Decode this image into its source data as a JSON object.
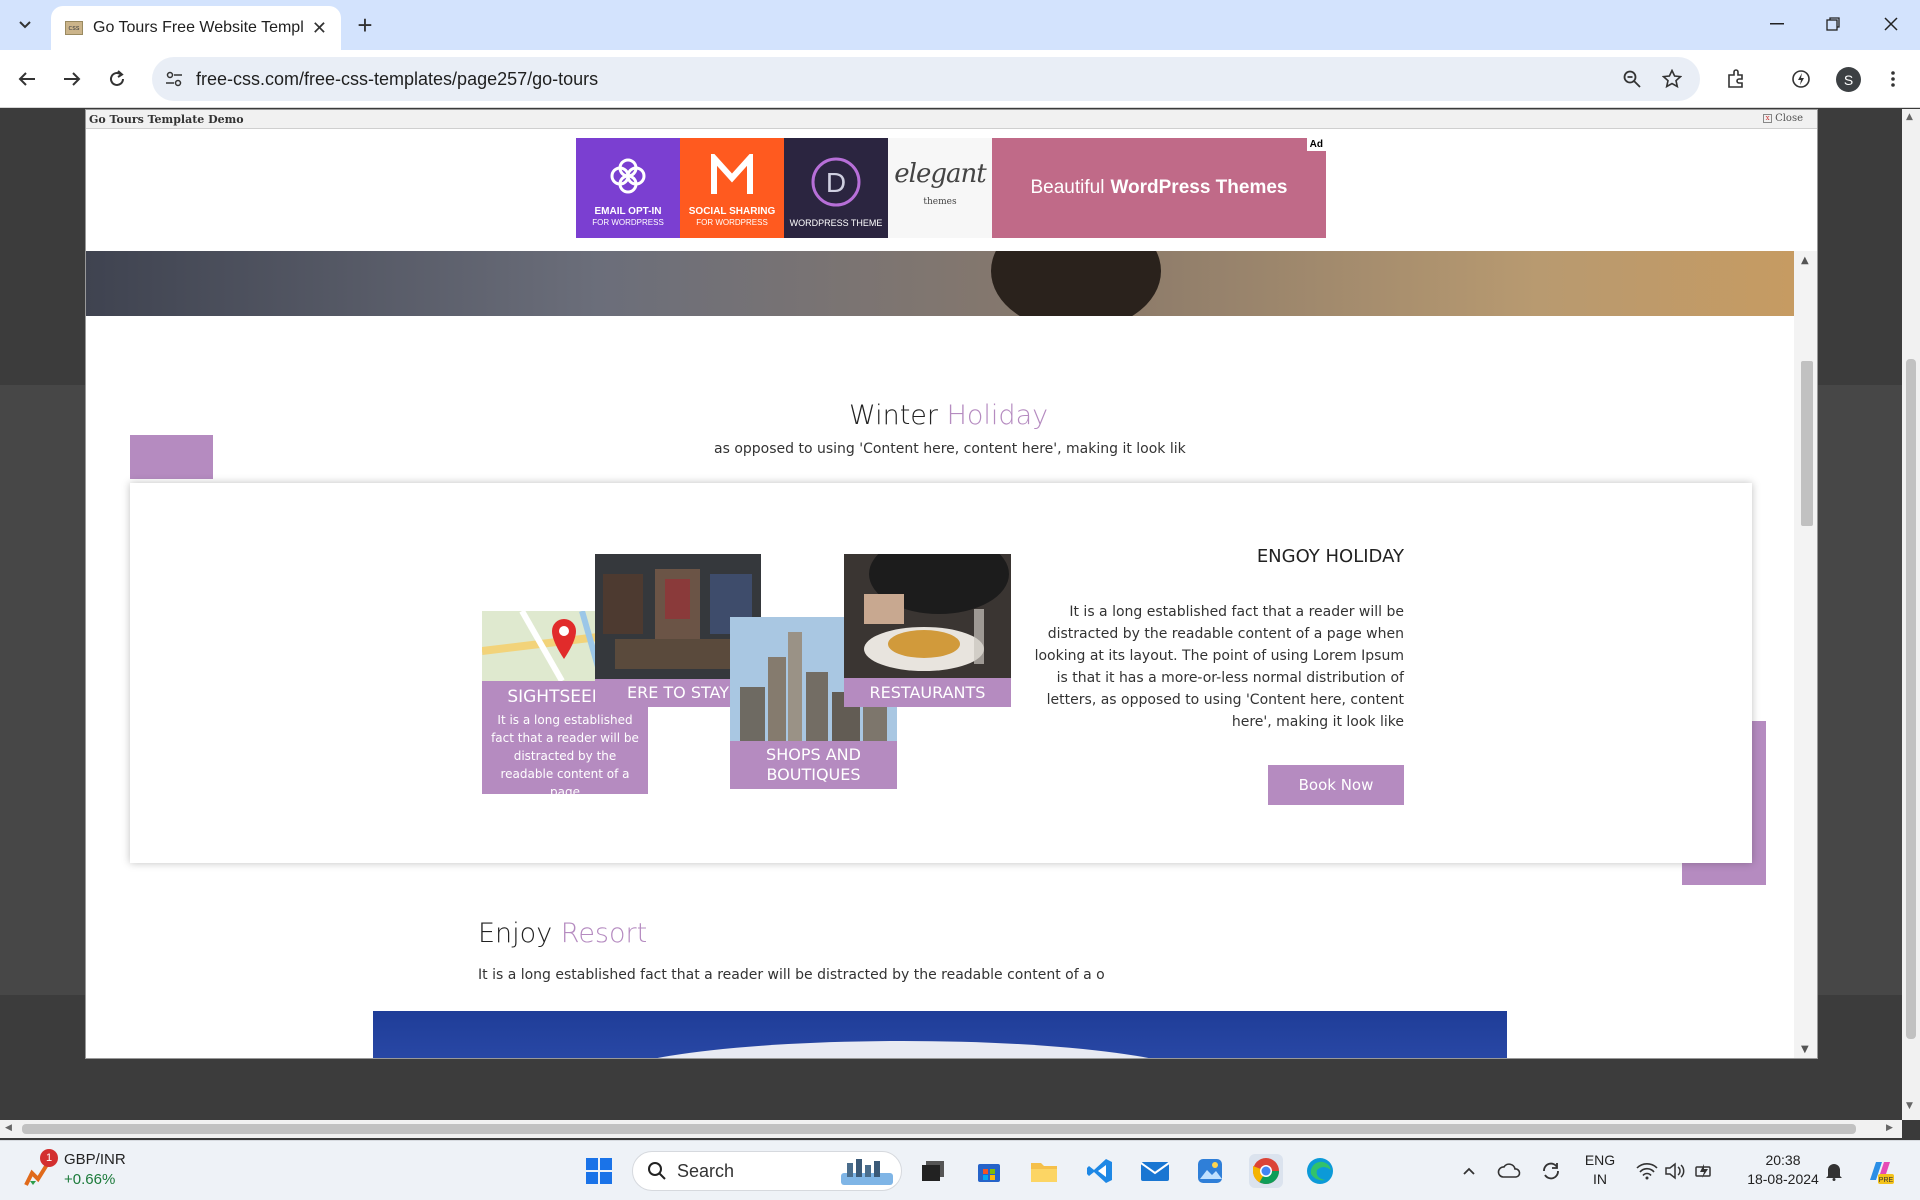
{
  "browser": {
    "tab_title": "Go Tours Free Website Template",
    "url": "free-css.com/free-css-templates/page257/go-tours",
    "profile_initial": "S"
  },
  "demo_bar": {
    "title": "Go Tours Template Demo",
    "close_label": "Close"
  },
  "ad": {
    "badge": "Ad",
    "tiles": [
      {
        "title": "EMAIL OPT-IN",
        "sub": "FOR WORDPRESS",
        "color": "#7b3fd1"
      },
      {
        "title": "SOCIAL SHARING",
        "sub": "FOR WORDPRESS",
        "color": "#ff5a1f"
      },
      {
        "title": "WORDPRESS THEME",
        "sub": "",
        "color": "#2b2540"
      }
    ],
    "elegant_logo": "elegant",
    "elegant_sub": "themes",
    "banner_prefix": "Beautiful",
    "banner_bold": "WordPress Themes"
  },
  "winter": {
    "title_plain": "Winter",
    "title_accent": "Holiday",
    "subtitle": "as opposed to using 'Content here, content here', making it look lik"
  },
  "tiles": {
    "sightseeing": {
      "label": "SIGHTSEEING",
      "text": "It is a long established fact that a reader will be distracted by the readable content of a page"
    },
    "where_to_stay": {
      "label": "ERE TO STAY"
    },
    "shops": {
      "label": "SHOPS AND BOUTIQUES"
    },
    "restaurants": {
      "label": "RESTAURANTS"
    }
  },
  "engoy": {
    "title": "ENGOY HOLIDAY",
    "text": "It is a long established fact that a reader will be distracted by the readable content of a page when looking at its layout. The point of using Lorem Ipsum is that it has a more-or-less normal distribution of letters, as opposed to using 'Content here, content here', making it look like",
    "button": "Book Now"
  },
  "resort": {
    "title_plain": "Enjoy",
    "title_accent": "Resort",
    "subtitle": "It is a long established fact that a reader will be distracted by the readable content of a o"
  },
  "taskbar": {
    "stock_pair": "GBP/INR",
    "stock_change": "+0.66%",
    "stock_badge": "1",
    "search_label": "Search",
    "lang_top": "ENG",
    "lang_bottom": "IN",
    "time": "20:38",
    "date": "18-08-2024"
  },
  "colors": {
    "accent": "#b58bc0",
    "tab_strip": "#d3e3fd"
  }
}
